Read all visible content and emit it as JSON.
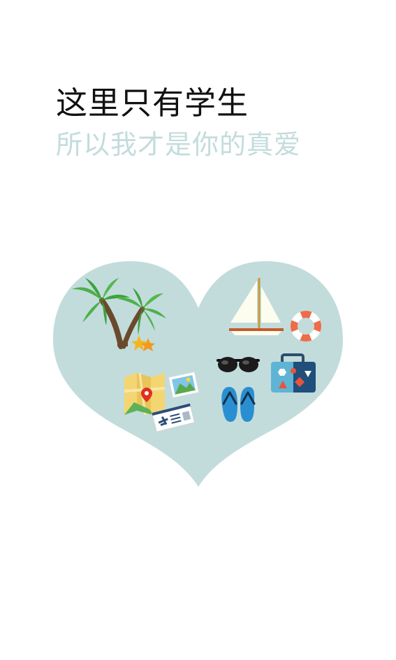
{
  "onboarding": {
    "headline": "这里只有学生",
    "subline": "所以我才是你的真爱"
  },
  "illustration": {
    "shape": "heart",
    "icons": [
      "palm-tree-icon",
      "starfish-icon",
      "sailboat-icon",
      "life-ring-icon",
      "sunglasses-icon",
      "suitcase-icon",
      "map-icon",
      "photo-icon",
      "boarding-pass-icon",
      "flip-flops-icon"
    ]
  },
  "colors": {
    "background": "#ffffff",
    "headline": "#111111",
    "subline": "#c3dcdc",
    "heart": "#c2dcdc"
  }
}
